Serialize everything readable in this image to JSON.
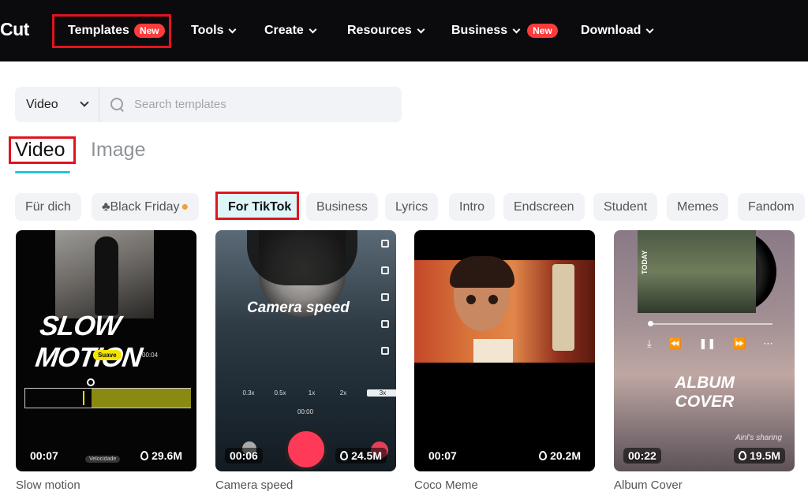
{
  "nav": {
    "logo": "Cut",
    "items": [
      {
        "label": "Templates",
        "badge": "New"
      },
      {
        "label": "Tools"
      },
      {
        "label": "Create"
      },
      {
        "label": "Resources"
      },
      {
        "label": "Business",
        "badge": "New"
      },
      {
        "label": "Download"
      }
    ]
  },
  "search": {
    "type_label": "Video",
    "placeholder": "Search templates"
  },
  "tabs": [
    {
      "label": "Video",
      "active": true
    },
    {
      "label": "Image",
      "active": false
    }
  ],
  "categories": [
    {
      "label": "Für dich"
    },
    {
      "label": "♣Black Friday"
    },
    {
      "label": "For TikTok",
      "active": true
    },
    {
      "label": "Business"
    },
    {
      "label": "Lyrics"
    },
    {
      "label": "Intro"
    },
    {
      "label": "Endscreen"
    },
    {
      "label": "Student"
    },
    {
      "label": "Memes"
    },
    {
      "label": "Fandom"
    }
  ],
  "templates": [
    {
      "title": "Slow motion",
      "duration": "00:07",
      "likes": "29.6M",
      "overlay": {
        "headline": "SLOW MOTION",
        "tag": "Suave",
        "time": "00:04",
        "speed_label": "Velocidade"
      }
    },
    {
      "title": "Camera speed",
      "duration": "00:06",
      "likes": "24.5M",
      "overlay": {
        "headline": "Camera speed",
        "speeds": [
          "0.3x",
          "0.5x",
          "1x",
          "2x",
          "3x"
        ],
        "timecode": "00:00"
      }
    },
    {
      "title": "Coco Meme",
      "duration": "00:07",
      "likes": "20.2M"
    },
    {
      "title": "Album Cover",
      "duration": "00:22",
      "likes": "19.5M",
      "overlay": {
        "headline_line1": "ALBUM",
        "headline_line2": "COVER",
        "side_text": "TODAY",
        "signature": "Ainl's sharing"
      }
    }
  ],
  "colors": {
    "nav_bg": "#0b0b0d",
    "badge": "#ff3b3b",
    "highlight_box": "#e0141e",
    "tab_underline": "#25c5d6",
    "chip_active_bg": "#dff6f8"
  }
}
